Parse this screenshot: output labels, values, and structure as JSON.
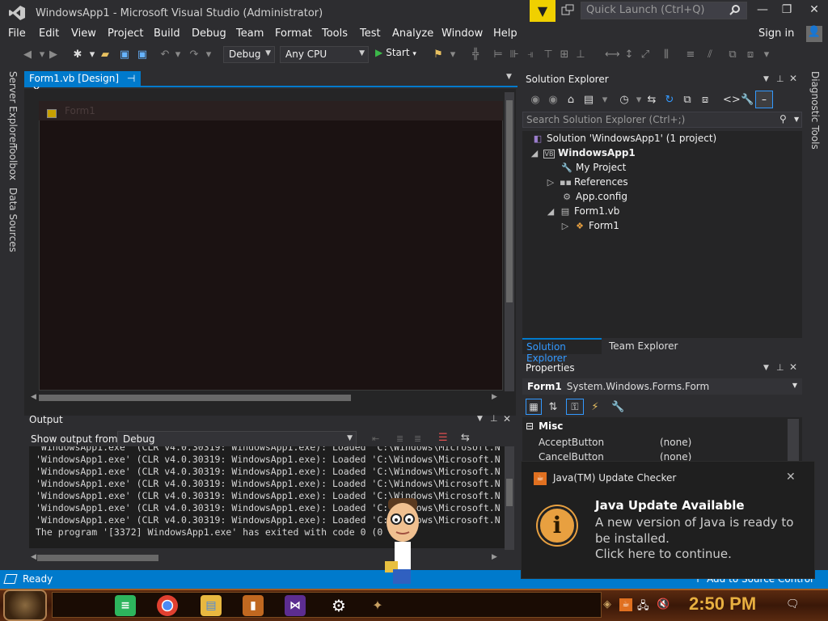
{
  "window": {
    "title": "WindowsApp1 - Microsoft Visual Studio  (Administrator)",
    "quick_launch_placeholder": "Quick Launch (Ctrl+Q)",
    "sign_in": "Sign in"
  },
  "menu": [
    "File",
    "Edit",
    "View",
    "Project",
    "Build",
    "Debug",
    "Team",
    "Format",
    "Tools",
    "Test",
    "Analyze",
    "Window",
    "Help"
  ],
  "toolbar": {
    "config": "Debug",
    "platform": "Any CPU",
    "start": "Start"
  },
  "left_tabs": [
    "Server Explorer",
    "Toolbox",
    "Data Sources"
  ],
  "right_tabs": [
    "Diagnostic Tools"
  ],
  "designer": {
    "tab_label": "Form1.vb [Design]",
    "form_title": "Form1"
  },
  "output": {
    "title": "Output",
    "show_from_label": "Show output from:",
    "show_from_value": "Debug",
    "lines": [
      " 'WindowsApp1.exe' (CLR v4.0.30319: WindowsApp1.exe): Loaded 'C:\\Windows\\Microsoft.N",
      " 'WindowsApp1.exe' (CLR v4.0.30319: WindowsApp1.exe): Loaded 'C:\\Windows\\Microsoft.N",
      " 'WindowsApp1.exe' (CLR v4.0.30319: WindowsApp1.exe): Loaded 'C:\\Windows\\Microsoft.N",
      " 'WindowsApp1.exe' (CLR v4.0.30319: WindowsApp1.exe): Loaded 'C:\\Windows\\Microsoft.N",
      " 'WindowsApp1.exe' (CLR v4.0.30319: WindowsApp1.exe): Loaded 'C:\\Windows\\Microsoft.N",
      " 'WindowsApp1.exe' (CLR v4.0.30319: WindowsApp1.exe): Loaded 'C:\\Windows\\Microsoft.N",
      " 'WindowsApp1.exe' (CLR v4.0.30319: WindowsApp1.exe): Loaded 'C:\\Windows\\Microsoft.N",
      " The program '[3372] WindowsApp1.exe' has exited with code 0 (0"
    ]
  },
  "solution_explorer": {
    "title": "Solution Explorer",
    "search_placeholder": "Search Solution Explorer (Ctrl+;)",
    "solution": "Solution 'WindowsApp1' (1 project)",
    "project": "WindowsApp1",
    "my_project": "My Project",
    "references": "References",
    "app_config": "App.config",
    "form_file": "Form1.vb",
    "form_class": "Form1",
    "tab_solution": "Solution Explorer",
    "tab_team": "Team Explorer"
  },
  "properties": {
    "title": "Properties",
    "object_name": "Form1",
    "object_type": "System.Windows.Forms.Form",
    "category": "Misc",
    "rows": [
      {
        "name": "AcceptButton",
        "value": "(none)"
      },
      {
        "name": "CancelButton",
        "value": "(none)"
      }
    ]
  },
  "toast": {
    "app": "Java(TM) Update Checker",
    "title": "Java Update Available",
    "message": "A new version of Java is ready to be installed.",
    "link": "Click here to continue."
  },
  "status": {
    "text": "Ready",
    "source_control": "Add to Source Control"
  },
  "taskbar": {
    "clock": "2:50 PM"
  },
  "colors": {
    "accent": "#007acc",
    "editor_bg": "#1e1e1e",
    "chrome_bg": "#2d2d30",
    "java_orange": "#e8a040",
    "clock": "#e8b040"
  }
}
